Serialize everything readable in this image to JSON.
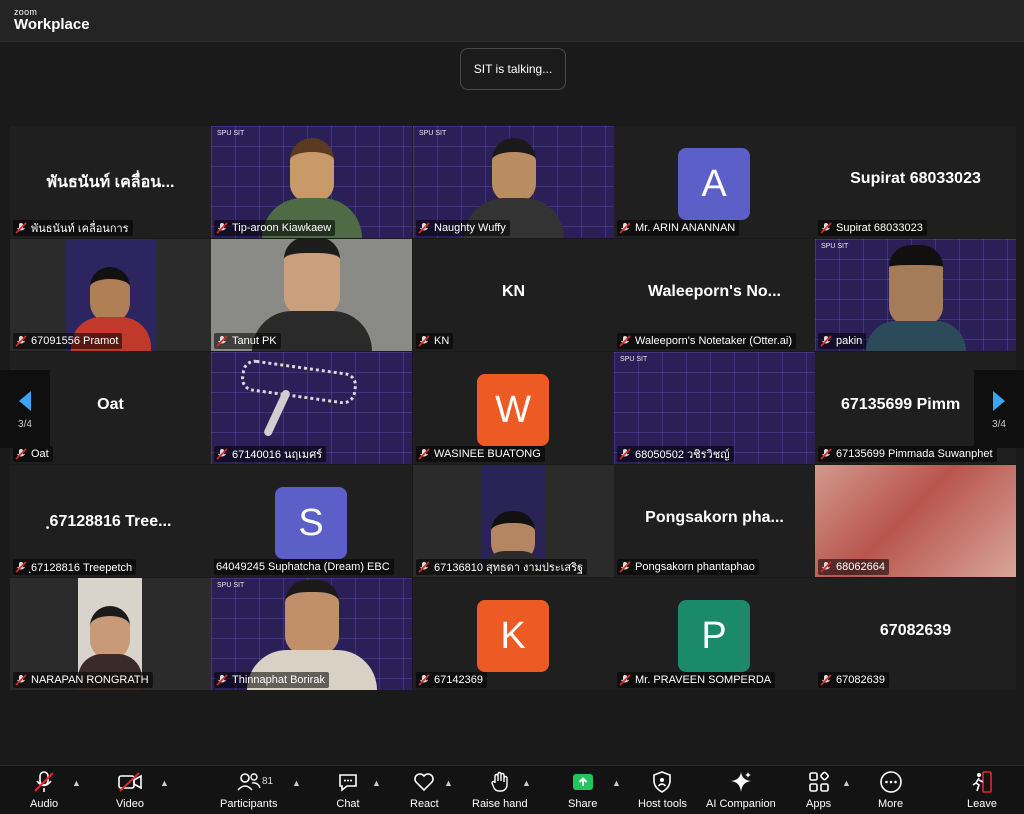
{
  "app": {
    "brand_small": "zoom",
    "brand": "Workplace"
  },
  "speaking": "SIT is talking...",
  "tiles": [
    {
      "name": "พันธนันท์ เคลื่อนการ",
      "display": "พันธนันท์ เคลื่อน..."
    },
    {
      "name": "Tip-aroon Kiawkaew"
    },
    {
      "name": "Naughty Wuffy"
    },
    {
      "name": "Mr. ARIN ANANNAN",
      "initial": "A",
      "color": "#5b5fc7"
    },
    {
      "name": "Supirat 68033023",
      "display": "Supirat 68033023"
    },
    {
      "name": "67091556 Pramot"
    },
    {
      "name": "Tanut PK"
    },
    {
      "name": "KN",
      "display": "KN"
    },
    {
      "name": "Waleeporn's Notetaker (Otter.ai)",
      "display": "Waleeporn's No..."
    },
    {
      "name": "pakin"
    },
    {
      "name": "Oat",
      "display": "Oat"
    },
    {
      "name": "67140016 นฤเมศร์"
    },
    {
      "name": "WASINEE BUATONG",
      "initial": "W",
      "color": "#ee5a24"
    },
    {
      "name": "68050502 วชิรวิชญ์"
    },
    {
      "name": "67135699 Pimmada Suwanphet",
      "display": "67135699  Pimm"
    },
    {
      "name": "ฺ67128816 Treepetch",
      "display": "ฺ67128816  Tree..."
    },
    {
      "name": "64049245 Suphatcha (Dream) EBC",
      "initial": "S",
      "color": "#5b5fc7"
    },
    {
      "name": "67136810 สุทธดา งามประเสริฐ"
    },
    {
      "name": "Pongsakorn phantaphao",
      "display": "Pongsakorn  pha..."
    },
    {
      "name": "68062664"
    },
    {
      "name": "NARAPAN RONGRATH"
    },
    {
      "name": "Thinnaphat Borirak"
    },
    {
      "name": "67142369",
      "initial": "K",
      "color": "#ee5a24"
    },
    {
      "name": "Mr. PRAVEEN SOMPERDA",
      "initial": "P",
      "color": "#1a8a6a"
    },
    {
      "name": "67082639",
      "display": "67082639"
    }
  ],
  "pager": {
    "left": "3/4",
    "right": "3/4"
  },
  "toolbar": {
    "audio": "Audio",
    "video": "Video",
    "participants": "Participants",
    "participants_count": "81",
    "chat": "Chat",
    "react": "React",
    "raise_hand": "Raise hand",
    "share": "Share",
    "host_tools": "Host tools",
    "ai_companion": "AI Companion",
    "apps": "Apps",
    "more": "More",
    "leave": "Leave"
  },
  "colors": {
    "share_green": "#22c55e",
    "muted_red": "#e02828",
    "leave_red": "#e02828"
  }
}
